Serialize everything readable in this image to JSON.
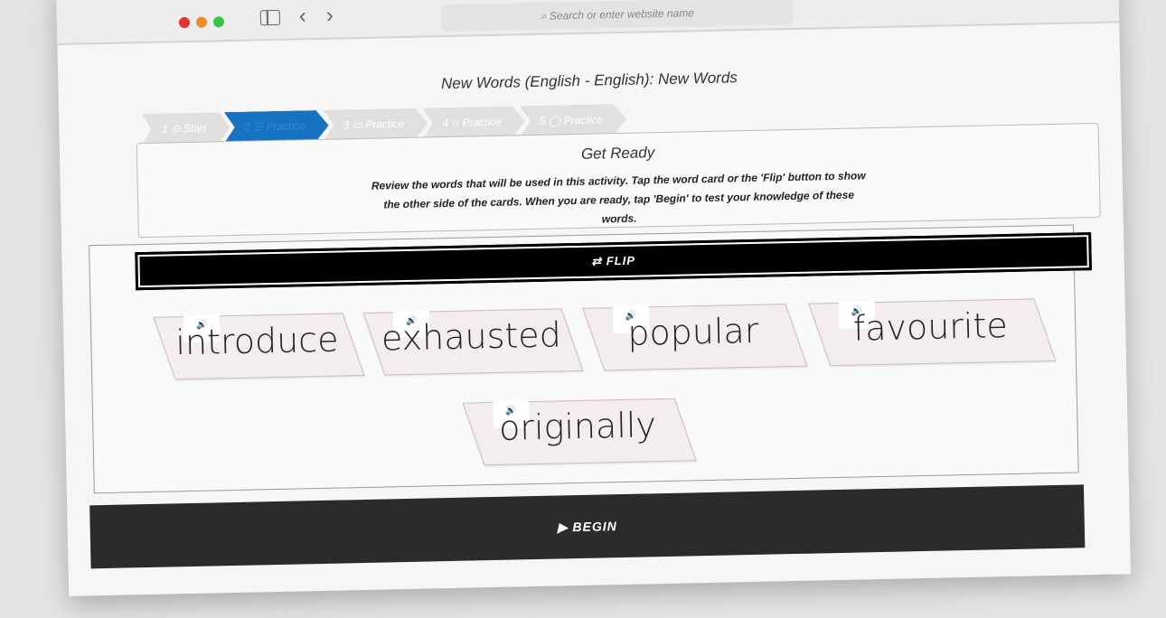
{
  "browser": {
    "url_placeholder": "Search or enter website name",
    "back_icon": "‹",
    "forward_icon": "›",
    "traffic": [
      "#e8322f",
      "#ef8a2d",
      "#33c648"
    ]
  },
  "page": {
    "title": "New Words (English - English): New Words"
  },
  "steps": [
    {
      "label": "1 ⊙ Start"
    },
    {
      "label": "2 ☰ Practice",
      "active": true
    },
    {
      "label": "3 ▭ Practice"
    },
    {
      "label": "4 ∩ Practice"
    },
    {
      "label": "5 ◯ Practice"
    }
  ],
  "instructions": {
    "heading": "Get Ready",
    "text": "Review the words that will be used in this activity. Tap the word card or the 'Flip' button to show the other side of the cards. When you are ready, tap 'Begin' to test your knowledge of these words."
  },
  "flip": {
    "label": "⇄ FLIP"
  },
  "cards": [
    {
      "word": "introduce"
    },
    {
      "word": "exhausted"
    },
    {
      "word": "popular"
    },
    {
      "word": "favourite"
    },
    {
      "word": "originally"
    }
  ],
  "speaker_icon": "🔊",
  "begin": {
    "label": "▶ BEGIN"
  },
  "colors": {
    "accent": "#1773c2",
    "begin_bg": "#2b2b2d"
  }
}
